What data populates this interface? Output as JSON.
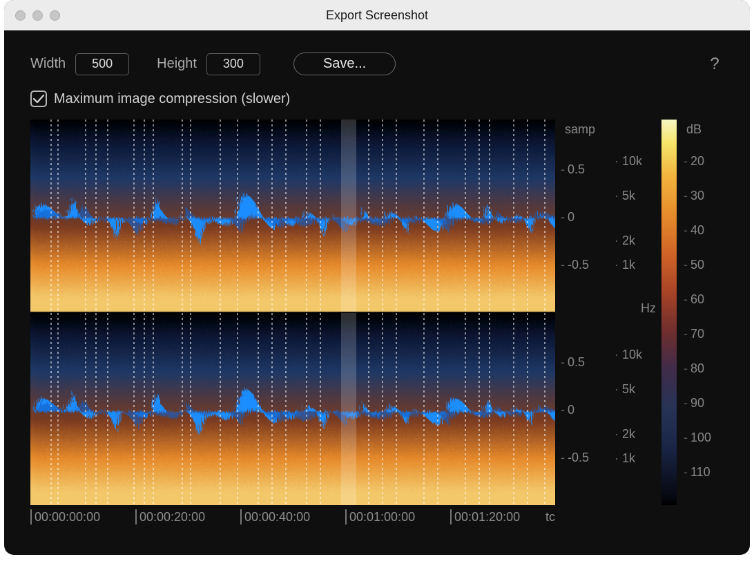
{
  "window": {
    "title": "Export Screenshot"
  },
  "controls": {
    "width_label": "Width",
    "width_value": "500",
    "height_label": "Height",
    "height_value": "300",
    "save_label": "Save...",
    "help_tooltip": "Help"
  },
  "checkbox": {
    "checked": true,
    "label": "Maximum image compression (slower)"
  },
  "samp": {
    "unit": "samp",
    "ticks": [
      "0.5",
      "0",
      "-0.5"
    ]
  },
  "freq": {
    "unit": "Hz",
    "ticks": [
      "10k",
      "5k",
      "2k",
      "1k"
    ]
  },
  "db": {
    "unit": "dB",
    "ticks": [
      "20",
      "30",
      "40",
      "50",
      "60",
      "70",
      "80",
      "90",
      "100",
      "110"
    ]
  },
  "time": {
    "unit": "tc",
    "ticks": [
      "00:00:00:00",
      "00:00:20:00",
      "00:00:40:00",
      "00:01:00:00",
      "00:01:20:00"
    ]
  }
}
